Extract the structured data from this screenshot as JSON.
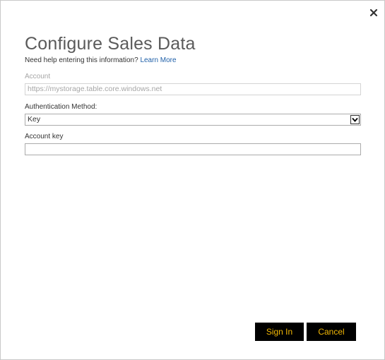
{
  "dialog": {
    "title": "Configure Sales Data",
    "help_text": "Need help entering this information?",
    "help_link": "Learn More"
  },
  "account": {
    "label": "Account",
    "placeholder": "https://mystorage.table.core.windows.net"
  },
  "auth": {
    "label": "Authentication Method:",
    "selected": "Key"
  },
  "account_key": {
    "label": "Account key",
    "value": ""
  },
  "buttons": {
    "sign_in": "Sign In",
    "cancel": "Cancel"
  },
  "icons": {
    "close": "close-icon",
    "dropdown": "chevron-down-icon"
  },
  "colors": {
    "button_bg": "#000000",
    "button_text": "#f2b705",
    "link": "#1e5fa8",
    "title": "#5a5a5a"
  }
}
